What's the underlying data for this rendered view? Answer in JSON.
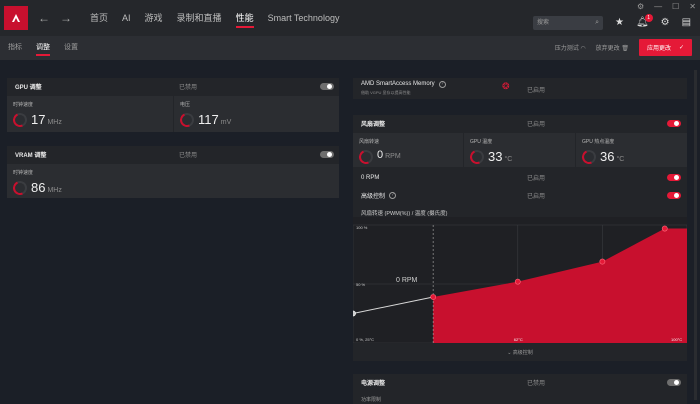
{
  "nav": {
    "items": [
      "首页",
      "AI",
      "游戏",
      "录制和直播",
      "性能",
      "Smart Technology"
    ],
    "active": "性能"
  },
  "search": {
    "placeholder": "搜索"
  },
  "notifications": {
    "count": "1"
  },
  "subnav": {
    "tabs": [
      "指标",
      "调整",
      "设置"
    ],
    "active": "调整",
    "stress_test": "压力测试",
    "discard": "放弃更改",
    "apply": "应用更改"
  },
  "gpu": {
    "title": "GPU 调整",
    "state": "已禁用",
    "enabled": false,
    "clock_label": "时钟速度",
    "clock_value": "17",
    "clock_unit": "MHz",
    "voltage_label": "电压",
    "voltage_value": "117",
    "voltage_unit": "mV"
  },
  "vram": {
    "title": "VRAM 调整",
    "state": "已禁用",
    "enabled": false,
    "clock_label": "时钟速度",
    "clock_value": "86",
    "clock_unit": "MHz"
  },
  "sam": {
    "title": "AMD SmartAccess Memory",
    "subtitle": "借助 VGPU 显存以提高性能",
    "state": "已启用"
  },
  "fan": {
    "title": "风扇调整",
    "state": "已启用",
    "enabled": true,
    "speed_label": "风扇转速",
    "speed_value": "0",
    "speed_unit": "RPM",
    "gpu_temp_label": "GPU 温度",
    "gpu_temp_value": "33",
    "gpu_temp_unit": "°C",
    "hotspot_label": "GPU 热点温度",
    "hotspot_value": "36",
    "hotspot_unit": "°C",
    "zero_rpm_label": "0 RPM",
    "zero_rpm_state": "已启用",
    "zero_rpm_enabled": true,
    "advanced_label": "高级控制",
    "advanced_state": "已启用",
    "advanced_enabled": true,
    "curve_title": "风扇转速 (PWM(%)) / 温度 (摄氏度)",
    "rpm_overlay": "0 RPM",
    "collapse_label": "高级控制"
  },
  "power": {
    "title": "电源调整",
    "state": "已禁用",
    "enabled": false,
    "sub_label": "功率限制"
  },
  "colors": {
    "accent": "#e51937",
    "background": "#1b1f27",
    "card": "#232529"
  },
  "chart_data": {
    "type": "area",
    "title": "风扇转速 (PWM(%)) / 温度 (摄氏度)",
    "xlabel": "",
    "ylabel": "",
    "y_tick_labels": [
      "100 %",
      "50 %",
      "0 %, 25°C"
    ],
    "x_tick_labels": [
      "0 %, 25°C",
      "62°C",
      "100°C"
    ],
    "series": [
      {
        "x": [
          25,
          43,
          62,
          81,
          95
        ],
        "y": [
          25,
          39,
          52,
          69,
          97
        ]
      }
    ],
    "xlim": [
      25,
      100
    ],
    "ylim": [
      0,
      100
    ],
    "grid": true
  }
}
